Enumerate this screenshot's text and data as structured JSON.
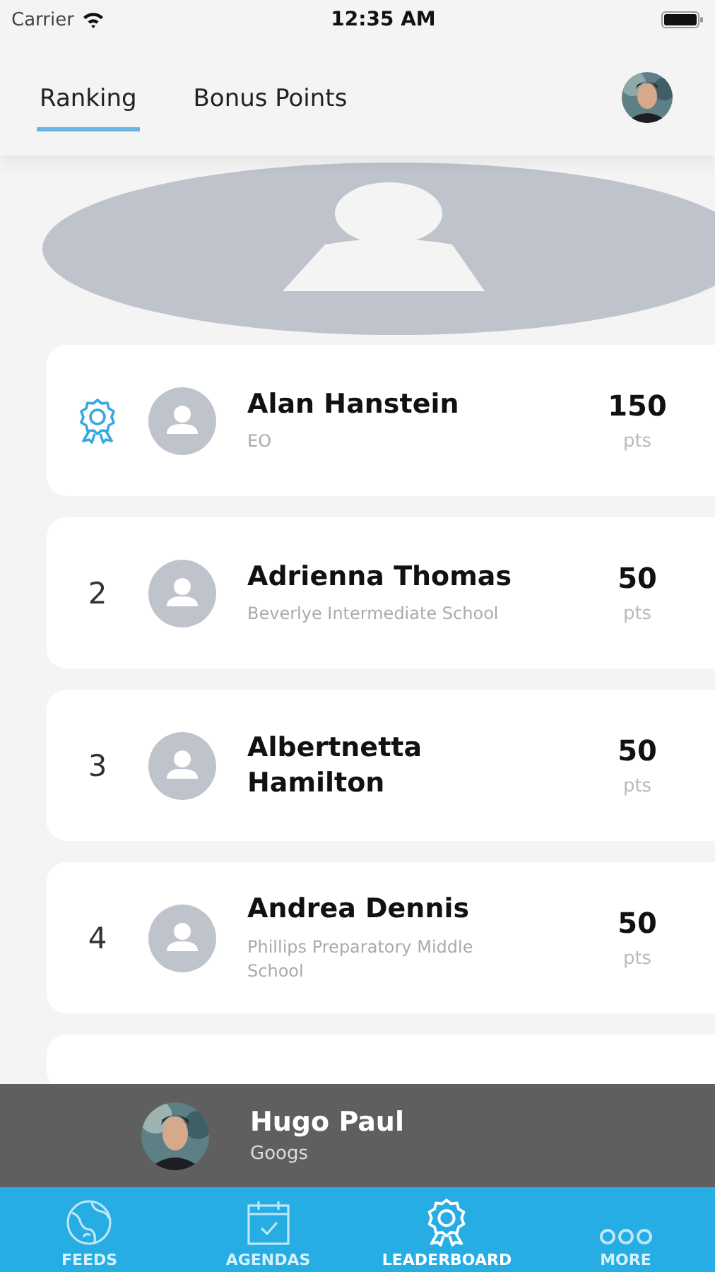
{
  "status_bar": {
    "carrier": "Carrier",
    "time": "12:35 AM"
  },
  "tabs": [
    {
      "label": "Ranking",
      "selected": true
    },
    {
      "label": "Bonus Points",
      "selected": false
    }
  ],
  "leaderboard": [
    {
      "kind": "badge",
      "name": "Alan Hanstein",
      "subtitle": "EO",
      "points": "150",
      "unit": "pts"
    },
    {
      "kind": "number",
      "rank": "2",
      "name": "Adrienna Thomas",
      "subtitle": "Beverlye Intermediate School",
      "points": "50",
      "unit": "pts"
    },
    {
      "kind": "number",
      "rank": "3",
      "name": "Albertnetta Hamilton",
      "points": "50",
      "unit": "pts"
    },
    {
      "kind": "number",
      "rank": "4",
      "name": "Andrea Dennis",
      "subtitle": "Phillips Preparatory Middle School",
      "points": "50",
      "unit": "pts"
    }
  ],
  "current_user": {
    "name": "Hugo Paul",
    "subtitle": "Googs"
  },
  "tab_bar": [
    {
      "kind": "globe",
      "label": "FEEDS",
      "selected": false
    },
    {
      "kind": "calendar",
      "label": "AGENDAS",
      "selected": false
    },
    {
      "kind": "award",
      "label": "LEADERBOARD",
      "selected": true
    },
    {
      "kind": "more",
      "label": "MORE",
      "selected": false
    }
  ]
}
